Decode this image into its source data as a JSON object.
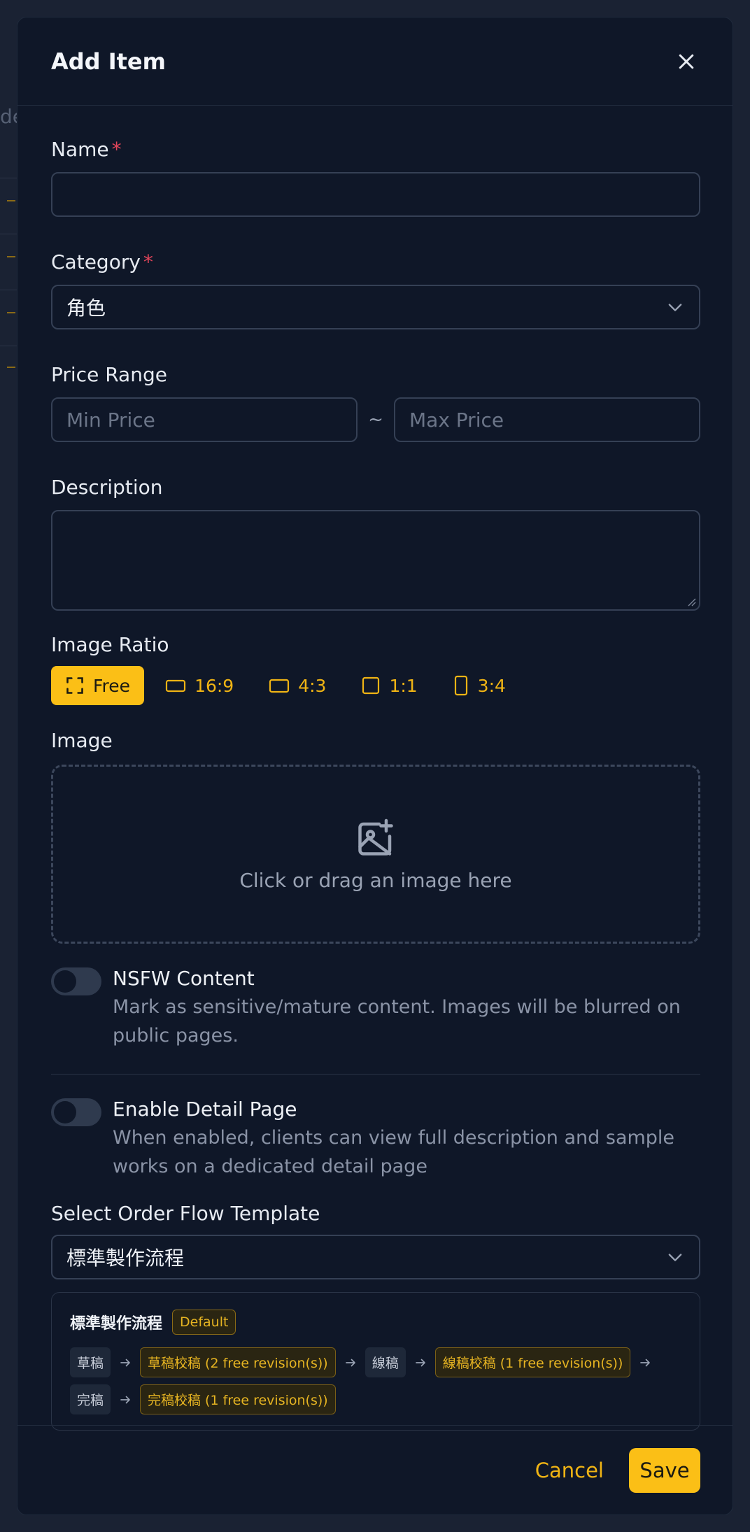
{
  "dialog": {
    "title": "Add Item",
    "close_icon": "close-icon"
  },
  "fields": {
    "name": {
      "label": "Name",
      "required_mark": "*",
      "value": ""
    },
    "category": {
      "label": "Category",
      "required_mark": "*",
      "selected": "角色"
    },
    "price_range": {
      "label": "Price Range",
      "min_placeholder": "Min Price",
      "separator": "~",
      "max_placeholder": "Max Price"
    },
    "description": {
      "label": "Description",
      "value": ""
    },
    "image_ratio": {
      "label": "Image Ratio",
      "options": [
        {
          "label": "Free",
          "icon": "crop-free-icon",
          "selected": true
        },
        {
          "label": "16:9",
          "icon": "ratio-16-9-icon",
          "selected": false
        },
        {
          "label": "4:3",
          "icon": "ratio-4-3-icon",
          "selected": false
        },
        {
          "label": "1:1",
          "icon": "ratio-1-1-icon",
          "selected": false
        },
        {
          "label": "3:4",
          "icon": "ratio-3-4-icon",
          "selected": false
        }
      ]
    },
    "image": {
      "label": "Image",
      "dropzone_text": "Click or drag an image here",
      "icon": "image-plus-icon"
    },
    "nsfw": {
      "title": "NSFW Content",
      "description": "Mark as sensitive/mature content. Images will be blurred on public pages.",
      "enabled": false
    },
    "detail_page": {
      "title": "Enable Detail Page",
      "description": "When enabled, clients can view full description and sample works on a dedicated detail page",
      "enabled": false
    },
    "order_flow": {
      "label": "Select Order Flow Template",
      "selected": "標準製作流程"
    }
  },
  "flow_preview": {
    "name": "標準製作流程",
    "badge": "Default",
    "steps": [
      {
        "label": "草稿",
        "kind": "stage"
      },
      {
        "label": "草稿校稿  (2 free revision(s))",
        "kind": "review"
      },
      {
        "label": "線稿",
        "kind": "stage"
      },
      {
        "label": "線稿校稿  (1 free revision(s))",
        "kind": "review"
      },
      {
        "label": "完稿",
        "kind": "stage"
      },
      {
        "label": "完稿校稿  (1 free revision(s))",
        "kind": "review"
      }
    ]
  },
  "footer": {
    "cancel_label": "Cancel",
    "save_label": "Save"
  },
  "colors": {
    "accent": "#fbbf16",
    "required": "#e2455a",
    "dialog_bg": "#0f1728"
  }
}
